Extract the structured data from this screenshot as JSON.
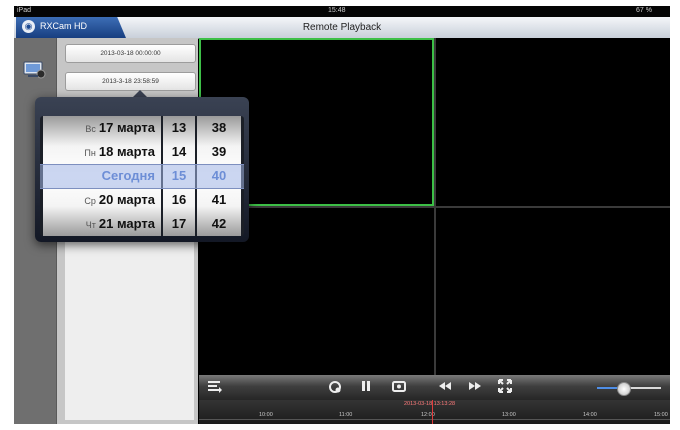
{
  "statusbar": {
    "device": "iPad",
    "time": "15:48",
    "battery": "67 %"
  },
  "app_tab": {
    "label": "RXCam HD"
  },
  "nav": {
    "title": "Remote Playback"
  },
  "search": {
    "start_date": "2013-03-18 00:00:00",
    "end_date": "2013-3-18 23:58:59"
  },
  "picker": {
    "days": [
      {
        "weekday": "Вс",
        "date": "17 марта"
      },
      {
        "weekday": "Пн",
        "date": "18 марта"
      },
      {
        "weekday": "",
        "date": "Сегодня"
      },
      {
        "weekday": "Ср",
        "date": "20 марта"
      },
      {
        "weekday": "Чт",
        "date": "21 марта"
      }
    ],
    "hours": [
      "13",
      "14",
      "15",
      "16",
      "17"
    ],
    "minutes": [
      "38",
      "39",
      "40",
      "41",
      "42"
    ]
  },
  "controls": {
    "menu_icon": "list-icon",
    "icons": [
      "refresh-icon",
      "pause-icon",
      "camera-icon",
      "rewind-icon",
      "fast-forward-icon",
      "fullscreen-icon"
    ],
    "volume": 0.4
  },
  "timeline": {
    "current": "2013-03-18 13:13:28",
    "ticks": [
      "10:00",
      "11:00",
      "12:00",
      "13:00",
      "14:00",
      "15:00"
    ]
  },
  "colors": {
    "selected_cell": "#3dbf47",
    "timeline_cursor": "#e33b3b",
    "app_tab": "#2a5ca8"
  }
}
